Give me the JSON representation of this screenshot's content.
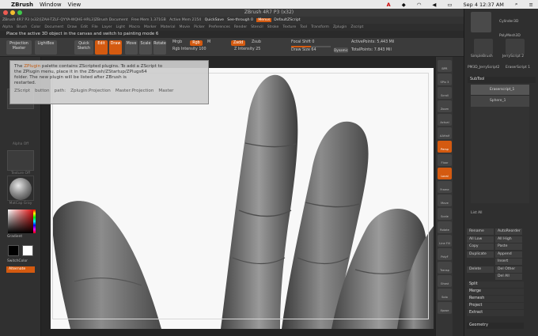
{
  "menubar": {
    "app": "ZBrush",
    "items": [
      "Window",
      "View"
    ],
    "date_time": "Sep 4  12:37 AM"
  },
  "window": {
    "title": "ZBrush 4R7 P3 (x32)"
  },
  "inforow": {
    "left": "ZBrush 4R7 P3 (x32)[ZAH-TZLF-QYYA-WQHE-HRL3]ZBrush Document",
    "mem": "Free Mem 1.371GB",
    "active": "Active Mem 2154",
    "quicksave": "QuickSave",
    "seethrough": "See-through  0",
    "menus": "Menus",
    "script": "DefaultZScript"
  },
  "zmenus": [
    "Alpha",
    "Brush",
    "Color",
    "Document",
    "Draw",
    "Edit",
    "File",
    "Layer",
    "Light",
    "Macro",
    "Marker",
    "Material",
    "Movie",
    "Picker",
    "Preferences",
    "Render",
    "Stencil",
    "Stroke",
    "Texture",
    "Tool",
    "Transform",
    "Zplugin",
    "Zscript"
  ],
  "notice": "Place the active 3D object in the canvas and switch to painting mode  6",
  "shelf": {
    "projection": "Projection Master",
    "lightbox": "LightBox",
    "quicksketch": "Quick Sketch",
    "edit": "Edit",
    "draw": "Draw",
    "move": "Move",
    "scale": "Scale",
    "rotate": "Rotate",
    "mrgb": "Mrgb",
    "rgb": "Rgb",
    "m": "M",
    "rgb_intensity": "Rgb Intensity 100",
    "zadd": "Zadd",
    "zsub": "Zsub",
    "z_intensity": "Z Intensity 25",
    "focal_shift": "Focal Shift 0",
    "draw_size": "Draw Size 64",
    "dynamic": "Dynamic",
    "active_points": "ActivePoints: 5,443  Mil",
    "total_points": "TotalPoints: 7.843  Mil"
  },
  "lefttray": {
    "alpha_off": "Alpha Off",
    "texture_off": "Texture Off",
    "material": "MatCap Gray",
    "gradient": "Gradient",
    "switchcolor": "SwitchColor",
    "alternate": "Alternate"
  },
  "popup": {
    "line1_pre": "The ",
    "line1_hl": "ZPlugin",
    "line1_post": " palette contains ZScripted plugins. To add a ZScript to",
    "line2": "the ZPlugin menu, place it in the ZBrush/ZStartup/ZPlugs64",
    "line3": "folder. The new plugin will be listed after ZBrush is",
    "line4": "restarted.",
    "path_items": [
      "ZScript",
      "button",
      "path:",
      "Zplugin:Projection",
      "Master:Projection",
      "Master"
    ]
  },
  "rstrip": [
    "BPR",
    "SPix 3",
    "Scroll",
    "Zoom",
    "Actual",
    "AAHalf",
    "Persp",
    "Floor",
    "Local",
    "Frame",
    "Move",
    "Scale",
    "Rotate",
    "Line Fill",
    "PolyF",
    "Transp",
    "Ghost",
    "Solo",
    "Xpose"
  ],
  "rpal": {
    "tools": [
      "SimpleBrush",
      "PolyMesh3D",
      "Cylinder3D",
      "EraserScript 2",
      "SimpleBrush",
      "JerryScript 2",
      "PM3D_JerryScript2",
      "EraserScript 1"
    ],
    "subtool_title": "SubTool",
    "subtools": [
      "Eraserscript_1",
      "Sphere_1"
    ],
    "list_all": "List All",
    "buttons": [
      [
        "Rename",
        "AutoReorder"
      ],
      [
        "All Low",
        "All High"
      ],
      [
        "Copy",
        "Paste"
      ],
      [
        "Duplicate",
        "Append"
      ],
      [
        "",
        "Insert"
      ],
      [
        "Delete",
        "Del Other"
      ],
      [
        "",
        "Del All"
      ]
    ],
    "sections": [
      "Split",
      "Merge",
      "Remesh",
      "Project",
      "Extract",
      "Geometry"
    ]
  },
  "colors": {
    "accent": "#d45a10",
    "bg": "#2b2b2b",
    "canvas": "#f8f8f8"
  }
}
